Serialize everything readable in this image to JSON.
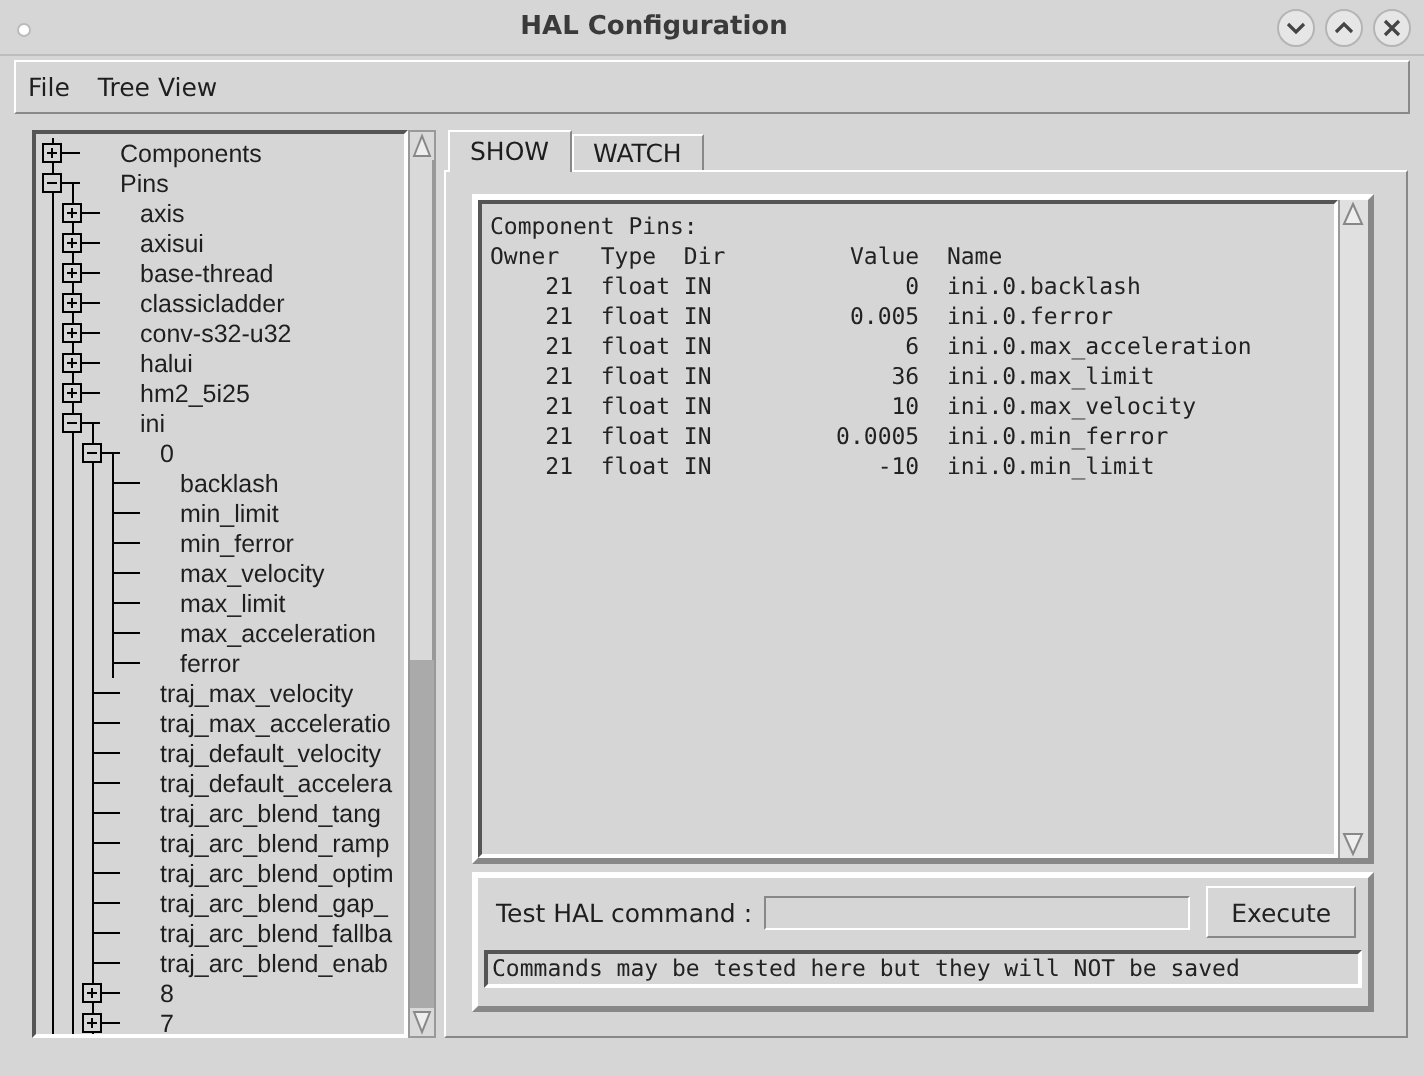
{
  "window": {
    "title": "HAL Configuration"
  },
  "menu": [
    "File",
    "Tree View"
  ],
  "tree": [
    {
      "label": "Components",
      "expanded": false
    },
    {
      "label": "Pins",
      "expanded": true,
      "children": [
        {
          "label": "axis",
          "expanded": false
        },
        {
          "label": "axisui",
          "expanded": false
        },
        {
          "label": "base-thread",
          "expanded": false
        },
        {
          "label": "classicladder",
          "expanded": false
        },
        {
          "label": "conv-s32-u32",
          "expanded": false
        },
        {
          "label": "halui",
          "expanded": false
        },
        {
          "label": "hm2_5i25",
          "expanded": false
        },
        {
          "label": "ini",
          "expanded": true,
          "children": [
            {
              "label": "0",
              "expanded": true,
              "children": [
                {
                  "label": "backlash"
                },
                {
                  "label": "min_limit"
                },
                {
                  "label": "min_ferror"
                },
                {
                  "label": "max_velocity"
                },
                {
                  "label": "max_limit"
                },
                {
                  "label": "max_acceleration"
                },
                {
                  "label": "ferror"
                }
              ]
            },
            {
              "label": "traj_max_velocity"
            },
            {
              "label": "traj_max_acceleratio"
            },
            {
              "label": "traj_default_velocity"
            },
            {
              "label": "traj_default_accelera"
            },
            {
              "label": "traj_arc_blend_tang"
            },
            {
              "label": "traj_arc_blend_ramp"
            },
            {
              "label": "traj_arc_blend_optim"
            },
            {
              "label": "traj_arc_blend_gap_"
            },
            {
              "label": "traj_arc_blend_fallba"
            },
            {
              "label": "traj_arc_blend_enab"
            },
            {
              "label": "8",
              "expanded": false
            },
            {
              "label": "7",
              "expanded": false
            }
          ]
        }
      ]
    }
  ],
  "tabs": [
    {
      "label": "SHOW",
      "selected": true
    },
    {
      "label": "WATCH",
      "selected": false
    }
  ],
  "output": {
    "heading": "Component Pins:",
    "columns": [
      "Owner",
      "Type",
      "Dir",
      "Value",
      "Name"
    ],
    "rows": [
      [
        "21",
        "float",
        "IN",
        "0",
        "ini.0.backlash"
      ],
      [
        "21",
        "float",
        "IN",
        "0.005",
        "ini.0.ferror"
      ],
      [
        "21",
        "float",
        "IN",
        "6",
        "ini.0.max_acceleration"
      ],
      [
        "21",
        "float",
        "IN",
        "36",
        "ini.0.max_limit"
      ],
      [
        "21",
        "float",
        "IN",
        "10",
        "ini.0.max_velocity"
      ],
      [
        "21",
        "float",
        "IN",
        "0.0005",
        "ini.0.min_ferror"
      ],
      [
        "21",
        "float",
        "IN",
        "-10",
        "ini.0.min_limit"
      ]
    ]
  },
  "command": {
    "label": "Test HAL command :",
    "button": "Execute",
    "status": "Commands may be tested here but they will NOT be saved"
  }
}
